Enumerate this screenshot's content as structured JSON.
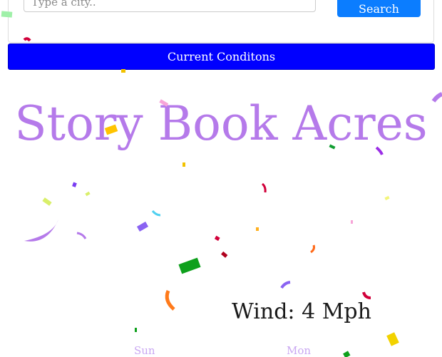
{
  "search": {
    "placeholder": "Type a city..",
    "button_label": "Search"
  },
  "current_conditions": {
    "button_label": "Current Conditons"
  },
  "location": {
    "title": "Story Book Acres"
  },
  "weather": {
    "wind": "Wind: 4 Mph"
  },
  "forecast": {
    "days": [
      "Sun",
      "Mon"
    ]
  },
  "colors": {
    "search_button": "#0b7dff",
    "conditions_button": "#0000ff",
    "title": "#b57aea",
    "day_label": "#c9a7f2"
  }
}
